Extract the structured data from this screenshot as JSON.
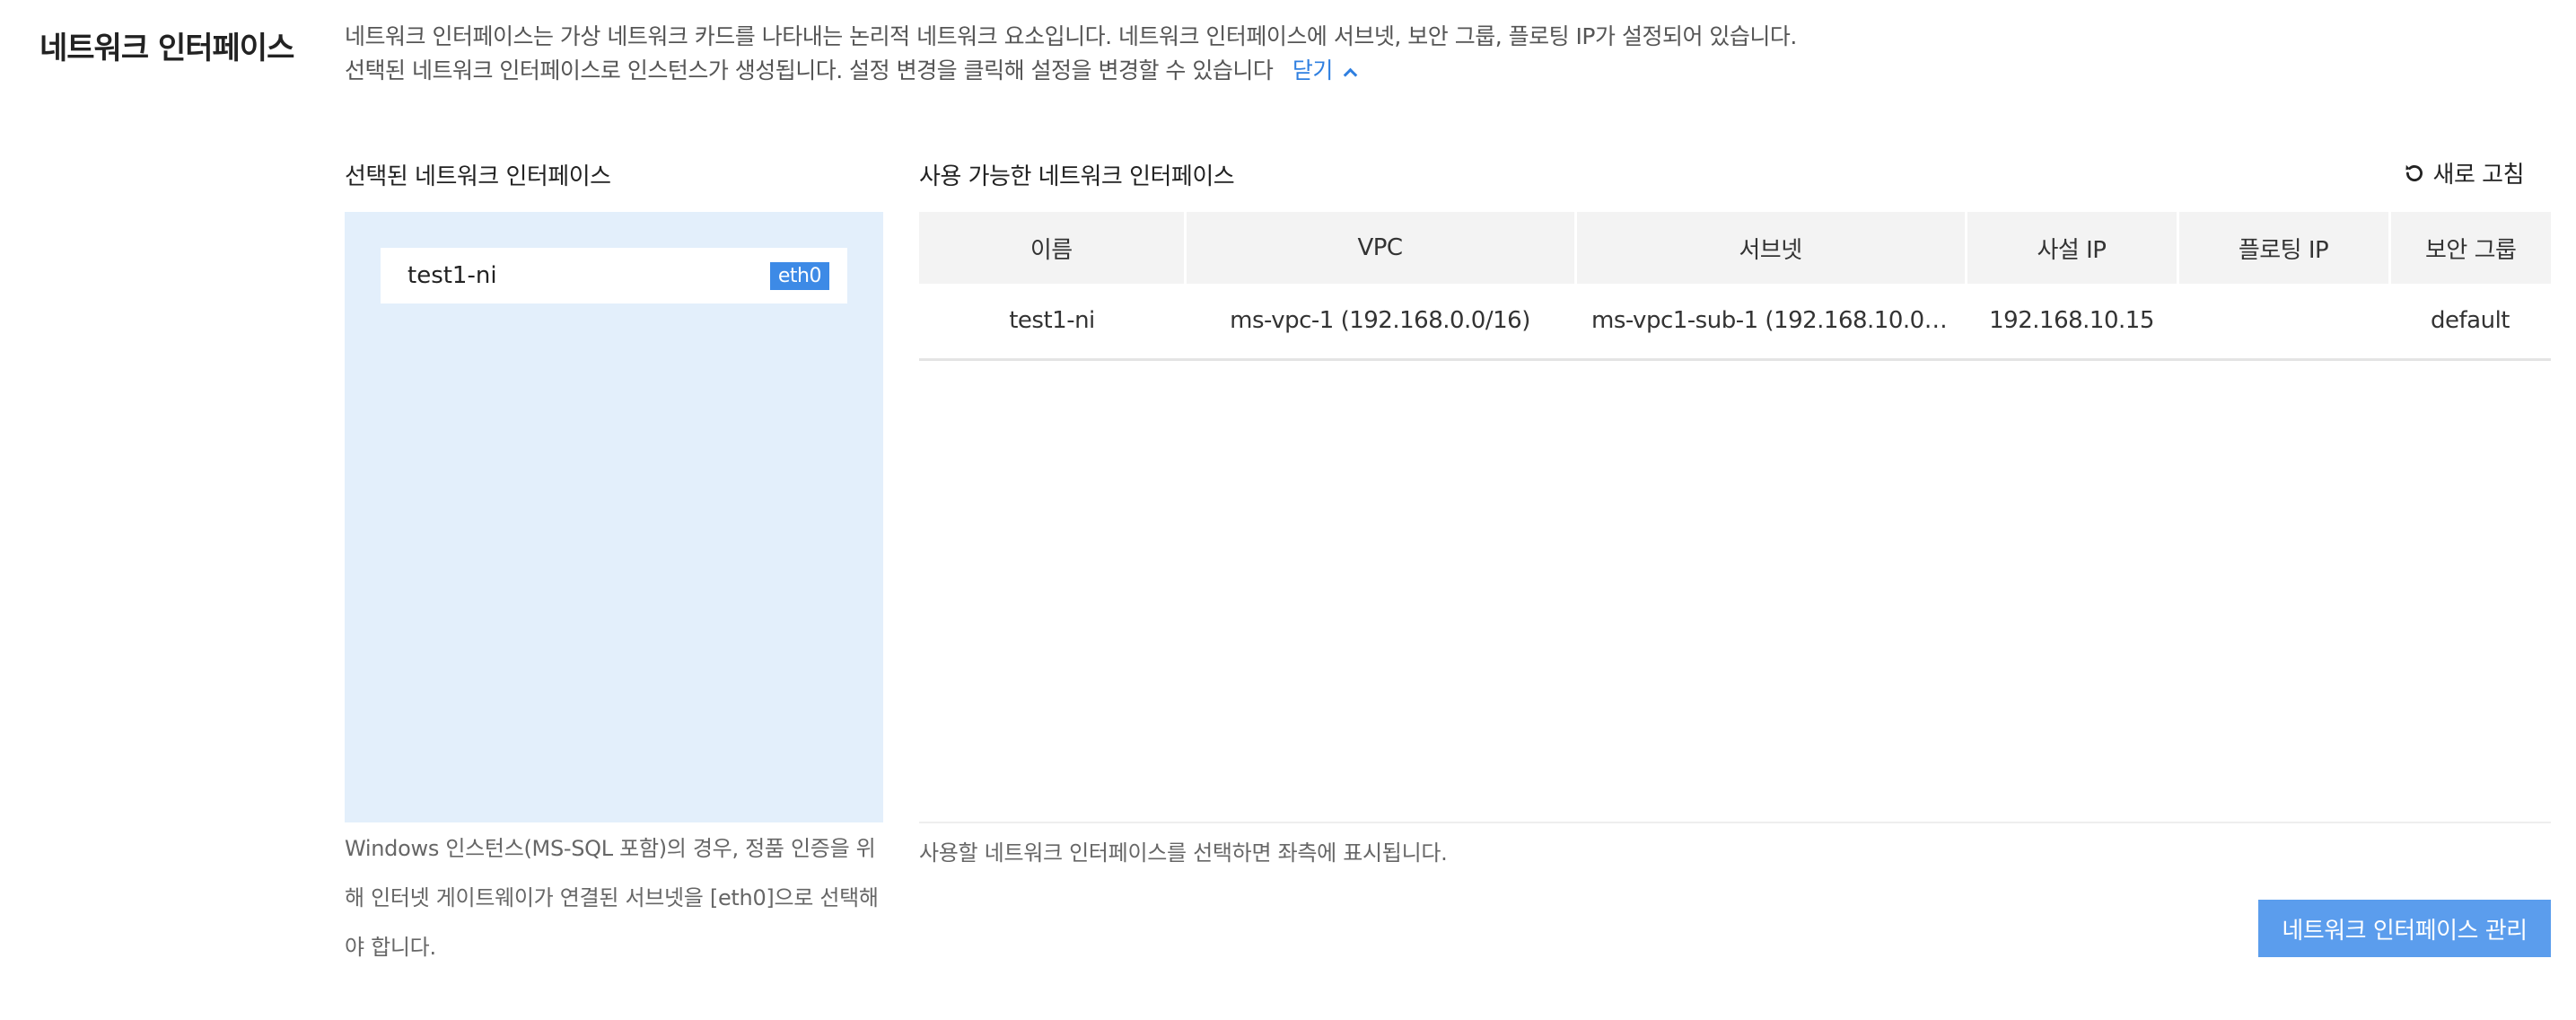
{
  "section": {
    "title": "네트워크 인터페이스",
    "desc_line1": "네트워크 인터페이스는 가상 네트워크 카드를 나타내는 논리적 네트워크 요소입니다. 네트워크 인터페이스에 서브넷, 보안 그룹, 플로팅 IP가 설정되어 있습니다.",
    "desc_line2": "선택된 네트워크 인터페이스로 인스턴스가 생성됩니다. 설정 변경을 클릭해 설정을 변경할 수 있습니다",
    "toggle_label": "닫기",
    "toggle_icon": "chevron-up-icon"
  },
  "selected": {
    "title": "선택된 네트워크 인터페이스",
    "items": [
      {
        "name": "test1-ni",
        "badge": "eth0"
      }
    ],
    "note": "Windows 인스턴스(MS-SQL 포함)의 경우, 정품 인증을 위해 인터넷 게이트웨이가 연결된 서브넷을 [eth0]으로 선택해야 합니다."
  },
  "available": {
    "title": "사용 가능한 네트워크 인터페이스",
    "refresh_label": "새로 고침",
    "refresh_icon": "refresh-icon",
    "columns": [
      "이름",
      "VPC",
      "서브넷",
      "사설 IP",
      "플로팅 IP",
      "보안 그룹"
    ],
    "rows": [
      {
        "name": "test1-ni",
        "vpc": "ms-vpc-1 (192.168.0.0/16)",
        "subnet": "ms-vpc1-sub-1 (192.168.10.0/...",
        "private_ip": "192.168.10.15",
        "floating_ip": "",
        "security_group": "default"
      }
    ],
    "note": "사용할 네트워크 인터페이스를 선택하면 좌측에 표시됩니다."
  },
  "actions": {
    "manage_label": "네트워크 인터페이스 관리"
  },
  "colors": {
    "accent": "#3d8ae6",
    "selected_panel_bg": "#e3effb",
    "button_bg": "#5b9ded",
    "link": "#2f7fe0"
  }
}
